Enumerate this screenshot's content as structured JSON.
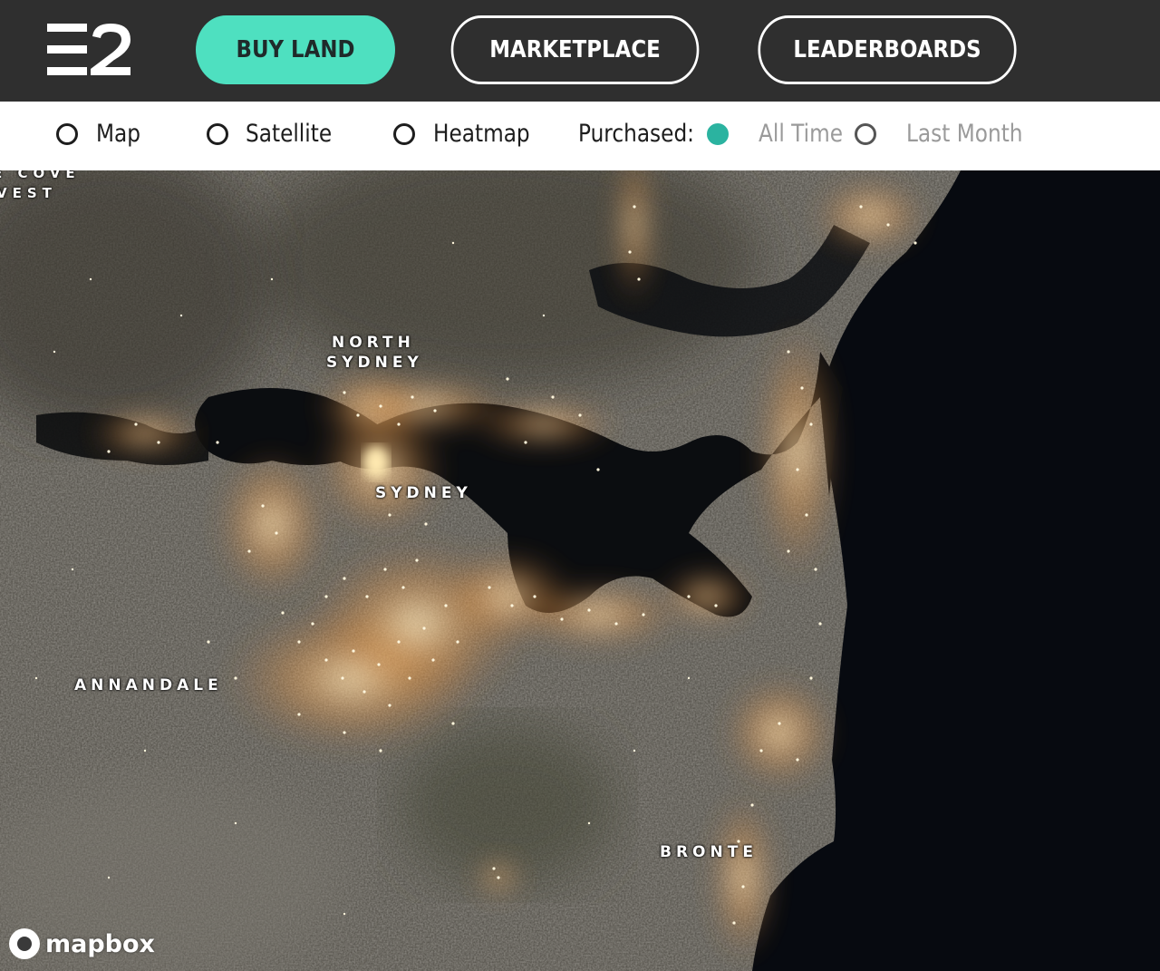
{
  "nav": {
    "buy_land": "BUY LAND",
    "marketplace": "MARKETPLACE",
    "leaderboards": "LEADERBOARDS"
  },
  "filters": {
    "map": "Map",
    "satellite": "Satellite",
    "heatmap": "Heatmap",
    "purchased_label": "Purchased:",
    "all_time": "All Time",
    "last_month": "Last Month",
    "selected_purchased": "All Time"
  },
  "map": {
    "labels": {
      "cove": "E COVE",
      "west": "VEST",
      "north": "NORTH",
      "sydney_north": "SYDNEY",
      "sydney": "SYDNEY",
      "annandale": "ANNANDALE",
      "bronte": "BRONTE"
    },
    "attribution": "mapbox"
  },
  "colors": {
    "topbar": "#2f2f2f",
    "accent": "#4ee0c0",
    "radio_selected": "#2bb3a0",
    "heat_glow": "#ffb65c"
  }
}
